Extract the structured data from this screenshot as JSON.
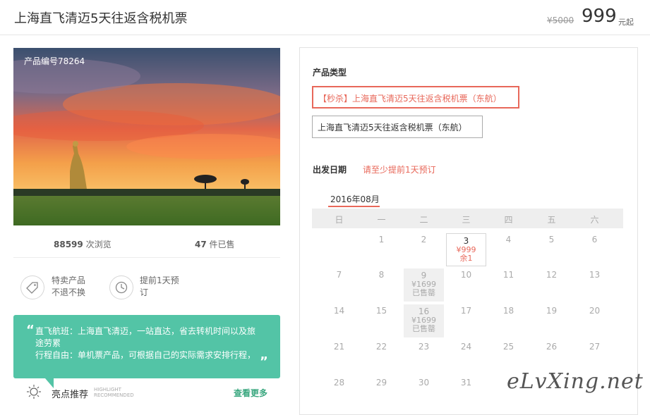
{
  "header": {
    "title": "上海直飞清迈5天往返含税机票",
    "old_price": "¥5000",
    "price": "999",
    "price_unit": "元起"
  },
  "product": {
    "code_label": "产品编号78264",
    "views_count": "88599",
    "views_label": "次浏览",
    "sold_count": "47",
    "sold_label": "件已售",
    "features": [
      {
        "icon": "tag-icon",
        "line1": "特卖产品",
        "line2": "不退不换"
      },
      {
        "icon": "clock-icon",
        "line1": "提前1天预",
        "line2": "订"
      }
    ]
  },
  "highlights": {
    "quote_open": "“",
    "quote_close": "”",
    "line1": "直飞航班：上海直飞清迈，一站直达，省去转机时间以及旅途劳累",
    "line2": "行程自由：单机票产品，可根据自己的实际需求安排行程，",
    "title": "亮点推荐",
    "sub_en1": "HIGHLIGHT",
    "sub_en2": "RECOMMENDED",
    "see_more": "查看更多"
  },
  "booking": {
    "type_label": "产品类型",
    "options": [
      {
        "label": "【秒杀】上海直飞清迈5天往返含税机票（东航）",
        "selected": true
      },
      {
        "label": "上海直飞清迈5天往返含税机票（东航）",
        "selected": false
      }
    ],
    "date_label": "出发日期",
    "date_hint": "请至少提前1天预订",
    "month": "2016年08月",
    "weekdays": [
      "日",
      "一",
      "二",
      "三",
      "四",
      "五",
      "六"
    ],
    "weeks": [
      [
        {
          "d": ""
        },
        {
          "d": "1"
        },
        {
          "d": "2"
        },
        {
          "d": "3",
          "price": "¥999",
          "status": "余1",
          "state": "available"
        },
        {
          "d": "4"
        },
        {
          "d": "5"
        },
        {
          "d": "6"
        }
      ],
      [
        {
          "d": "7"
        },
        {
          "d": "8"
        },
        {
          "d": "9",
          "price": "¥1699",
          "status": "已售罄",
          "state": "sold"
        },
        {
          "d": "10"
        },
        {
          "d": "11"
        },
        {
          "d": "12"
        },
        {
          "d": "13"
        }
      ],
      [
        {
          "d": "14"
        },
        {
          "d": "15"
        },
        {
          "d": "16",
          "price": "¥1699",
          "status": "已售罄",
          "state": "sold"
        },
        {
          "d": "17"
        },
        {
          "d": "18"
        },
        {
          "d": "19"
        },
        {
          "d": "20"
        }
      ],
      [
        {
          "d": "21"
        },
        {
          "d": "22"
        },
        {
          "d": "23"
        },
        {
          "d": "24"
        },
        {
          "d": "25"
        },
        {
          "d": "26"
        },
        {
          "d": "27"
        }
      ],
      [
        {
          "d": "28"
        },
        {
          "d": "29"
        },
        {
          "d": "30"
        },
        {
          "d": "31"
        },
        {
          "d": ""
        },
        {
          "d": ""
        },
        {
          "d": ""
        }
      ]
    ]
  },
  "watermark": "eLvXing.net",
  "colors": {
    "accent": "#e8685a",
    "green": "#53c4a6",
    "link": "#3aa77f"
  }
}
